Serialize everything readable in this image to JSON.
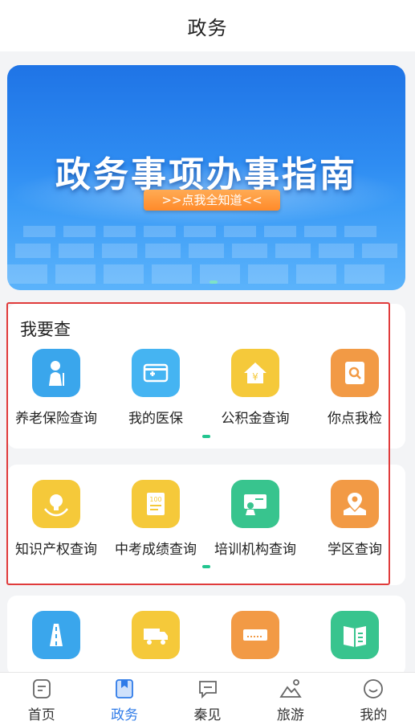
{
  "header": {
    "title": "政务"
  },
  "banner": {
    "title": "政务事项办事指南",
    "cta": ">>点我全知道<<"
  },
  "section": {
    "title": "我要查"
  },
  "row1": [
    {
      "label": "养老保险查询",
      "icon": "elderly-icon",
      "color": "#3aa6ec"
    },
    {
      "label": "我的医保",
      "icon": "medical-card-icon",
      "color": "#45b4f2"
    },
    {
      "label": "公积金查询",
      "icon": "house-fund-icon",
      "color": "#f5c93a"
    },
    {
      "label": "你点我检",
      "icon": "search-document-icon",
      "color": "#f29a45"
    }
  ],
  "row2": [
    {
      "label": "知识产权查询",
      "icon": "lightbulb-icon",
      "color": "#f5c93a"
    },
    {
      "label": "中考成绩查询",
      "icon": "score-sheet-icon",
      "color": "#f5c93a"
    },
    {
      "label": "培训机构查询",
      "icon": "classroom-icon",
      "color": "#38c48e"
    },
    {
      "label": "学区查询",
      "icon": "location-map-icon",
      "color": "#f29a45"
    }
  ],
  "row3": [
    {
      "icon": "road-icon",
      "color": "#3aa6ec"
    },
    {
      "icon": "truck-icon",
      "color": "#f5c93a"
    },
    {
      "icon": "device-icon",
      "color": "#f29a45"
    },
    {
      "icon": "book-icon",
      "color": "#38c48e"
    }
  ],
  "tabs": [
    {
      "label": "首页",
      "icon": "home-icon",
      "active": false
    },
    {
      "label": "政务",
      "icon": "bookmark-icon",
      "active": true
    },
    {
      "label": "秦见",
      "icon": "chat-icon",
      "active": false
    },
    {
      "label": "旅游",
      "icon": "mountain-icon",
      "active": false
    },
    {
      "label": "我的",
      "icon": "profile-icon",
      "active": false
    }
  ],
  "colors": {
    "accent": "#2f7be8",
    "pager": "#22c58f",
    "highlight": "#e03b3b",
    "cta": "#ff8a2a"
  }
}
